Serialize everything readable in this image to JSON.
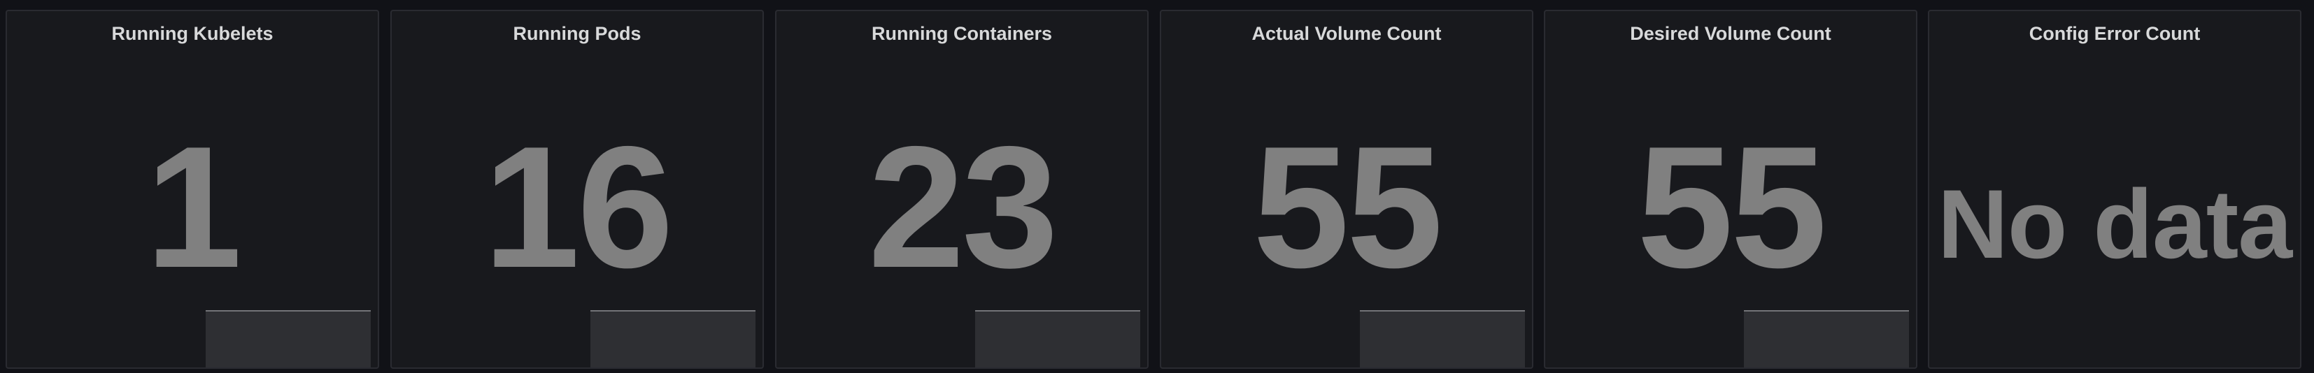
{
  "panels": [
    {
      "title": "Running Kubelets",
      "value": "1",
      "has_sparkline": true
    },
    {
      "title": "Running Pods",
      "value": "16",
      "has_sparkline": true
    },
    {
      "title": "Running Containers",
      "value": "23",
      "has_sparkline": true
    },
    {
      "title": "Actual Volume Count",
      "value": "55",
      "has_sparkline": true
    },
    {
      "title": "Desired Volume Count",
      "value": "55",
      "has_sparkline": true
    },
    {
      "title": "Config Error Count",
      "value": "No data",
      "has_sparkline": false
    }
  ],
  "colors": {
    "background": "#111217",
    "panel_background": "#18191d",
    "panel_border": "#2a2b31",
    "title_text": "#d8d9da",
    "value_text": "#808080",
    "sparkline_fill": "#2e2f33",
    "sparkline_line": "#737478"
  }
}
